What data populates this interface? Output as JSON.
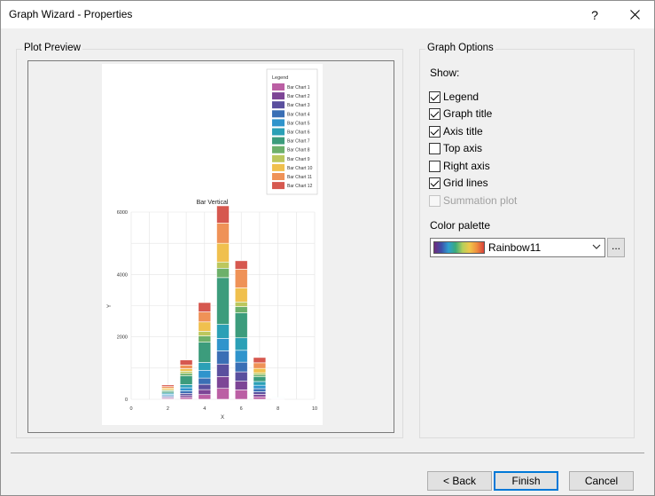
{
  "window": {
    "title": "Graph Wizard - Properties",
    "help_glyph": "?"
  },
  "preview": {
    "group_label": "Plot Preview",
    "legend_title": "Legend",
    "series_colors": [
      "#bb5fa4",
      "#7d4596",
      "#5a4f9e",
      "#3a6fb5",
      "#2f94cc",
      "#2ba0b6",
      "#3c9c7c",
      "#6db06a",
      "#bcc75d",
      "#f0c04e",
      "#ef9257",
      "#d6584f"
    ],
    "chart_data": {
      "type": "bar",
      "stacked": true,
      "title": "Bar Vertical",
      "xlabel": "X",
      "ylabel": "Y",
      "xlim": [
        0,
        10
      ],
      "ylim": [
        0,
        6000
      ],
      "xticks": [
        0,
        2,
        4,
        6,
        8,
        10
      ],
      "yticks": [
        0,
        2000,
        4000,
        6000
      ],
      "grid": true,
      "legend_position": "top-right",
      "x": [
        2,
        3,
        4,
        5,
        6,
        7,
        8
      ],
      "series": [
        {
          "name": "Bar Chart 1",
          "values": [
            30,
            60,
            150,
            350,
            300,
            80,
            10
          ]
        },
        {
          "name": "Bar Chart 2",
          "values": [
            30,
            60,
            160,
            380,
            280,
            80,
            10
          ]
        },
        {
          "name": "Bar Chart 3",
          "values": [
            30,
            70,
            170,
            400,
            300,
            80,
            10
          ]
        },
        {
          "name": "Bar Chart 4",
          "values": [
            30,
            80,
            200,
            420,
            310,
            100,
            10
          ]
        },
        {
          "name": "Bar Chart 5",
          "values": [
            40,
            100,
            250,
            400,
            380,
            110,
            10
          ]
        },
        {
          "name": "Bar Chart 6",
          "values": [
            40,
            100,
            250,
            450,
            400,
            120,
            10
          ]
        },
        {
          "name": "Bar Chart 7",
          "values": [
            50,
            280,
            650,
            1500,
            800,
            150,
            0
          ]
        },
        {
          "name": "Bar Chart 8",
          "values": [
            30,
            80,
            200,
            300,
            200,
            70,
            0
          ]
        },
        {
          "name": "Bar Chart 9",
          "values": [
            30,
            70,
            150,
            200,
            150,
            60,
            0
          ]
        },
        {
          "name": "Bar Chart 10",
          "values": [
            50,
            80,
            300,
            600,
            450,
            140,
            0
          ]
        },
        {
          "name": "Bar Chart 11",
          "values": [
            50,
            120,
            320,
            650,
            600,
            180,
            0
          ]
        },
        {
          "name": "Bar Chart 12",
          "values": [
            50,
            160,
            300,
            550,
            270,
            170,
            0
          ]
        }
      ]
    }
  },
  "options": {
    "group_label": "Graph Options",
    "show_label": "Show:",
    "items": [
      {
        "label": "Legend",
        "checked": true,
        "disabled": false
      },
      {
        "label": "Graph title",
        "checked": true,
        "disabled": false
      },
      {
        "label": "Axis title",
        "checked": true,
        "disabled": false
      },
      {
        "label": "Top axis",
        "checked": false,
        "disabled": false
      },
      {
        "label": "Right axis",
        "checked": false,
        "disabled": false
      },
      {
        "label": "Grid lines",
        "checked": true,
        "disabled": false
      },
      {
        "label": "Summation plot",
        "checked": false,
        "disabled": true
      }
    ],
    "palette_label": "Color palette",
    "palette_value": "Rainbow11",
    "more_label": "..."
  },
  "buttons": {
    "back": "< Back",
    "finish": "Finish",
    "cancel": "Cancel"
  }
}
